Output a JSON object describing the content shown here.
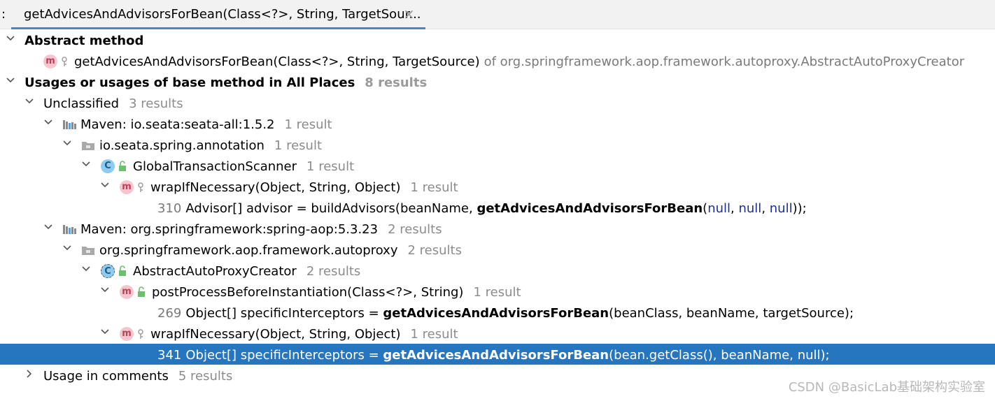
{
  "tab": {
    "prefix": ":",
    "title": "getAdvicesAndAdvisorsForBean(Class<?>, String, TargetSour...",
    "close_glyph": "×"
  },
  "tree": {
    "abstract_header": "Abstract method",
    "abstract_method": {
      "signature": "getAdvicesAndAdvisorsForBean(Class<?>, String, TargetSource)",
      "of_text": "of org.springframework.aop.framework.autoproxy.AbstractAutoProxyCreator"
    },
    "usages_header": {
      "label": "Usages or usages of base method in All Places",
      "count": "8 results"
    },
    "unclassified": {
      "label": "Unclassified",
      "count": "3 results"
    },
    "maven_seata": {
      "label": "Maven: io.seata:seata-all:1.5.2",
      "count": "1 result"
    },
    "pkg_seata": {
      "label": "io.seata.spring.annotation",
      "count": "1 result"
    },
    "class_gts": {
      "label": "GlobalTransactionScanner",
      "count": "1 result"
    },
    "method_wrap1": {
      "label": "wrapIfNecessary(Object, String, Object)",
      "count": "1 result"
    },
    "line_310": {
      "num": "310",
      "pre": "Advisor[] advisor = buildAdvisors(beanName, ",
      "hl": "getAdvicesAndAdvisorsForBean",
      "open": "(",
      "a1": "null",
      "sep1": ", ",
      "a2": "null",
      "sep2": ", ",
      "a3": "null",
      "close": "));"
    },
    "maven_spring": {
      "label": "Maven: org.springframework:spring-aop:5.3.23",
      "count": "2 results"
    },
    "pkg_spring": {
      "label": "org.springframework.aop.framework.autoproxy",
      "count": "2 results"
    },
    "class_aapc": {
      "label": "AbstractAutoProxyCreator",
      "count": "2 results"
    },
    "method_ppbi": {
      "label": "postProcessBeforeInstantiation(Class<?>, String)",
      "count": "1 result"
    },
    "line_269": {
      "num": "269",
      "pre": "Object[] specificInterceptors = ",
      "hl": "getAdvicesAndAdvisorsForBean",
      "post": "(beanClass, beanName, targetSource);"
    },
    "method_wrap2": {
      "label": "wrapIfNecessary(Object, String, Object)",
      "count": "1 result"
    },
    "line_341": {
      "num": "341",
      "pre": "Object[] specificInterceptors = ",
      "hl": "getAdvicesAndAdvisorsForBean",
      "post": "(bean.getClass(), beanName, null);"
    },
    "usage_comments": {
      "label": "Usage in comments",
      "count": "5 results"
    }
  },
  "icons": {
    "method": "m",
    "class": "C"
  },
  "watermark": "CSDN @BasicLab基础架构实验室",
  "colors": {
    "selection": "#2675bf",
    "tab_underline": "#4a86c8",
    "method_icon_bg": "#f6c6ce",
    "class_icon_bg": "#8ecbef",
    "keyword_null": "#1a2f9a"
  }
}
